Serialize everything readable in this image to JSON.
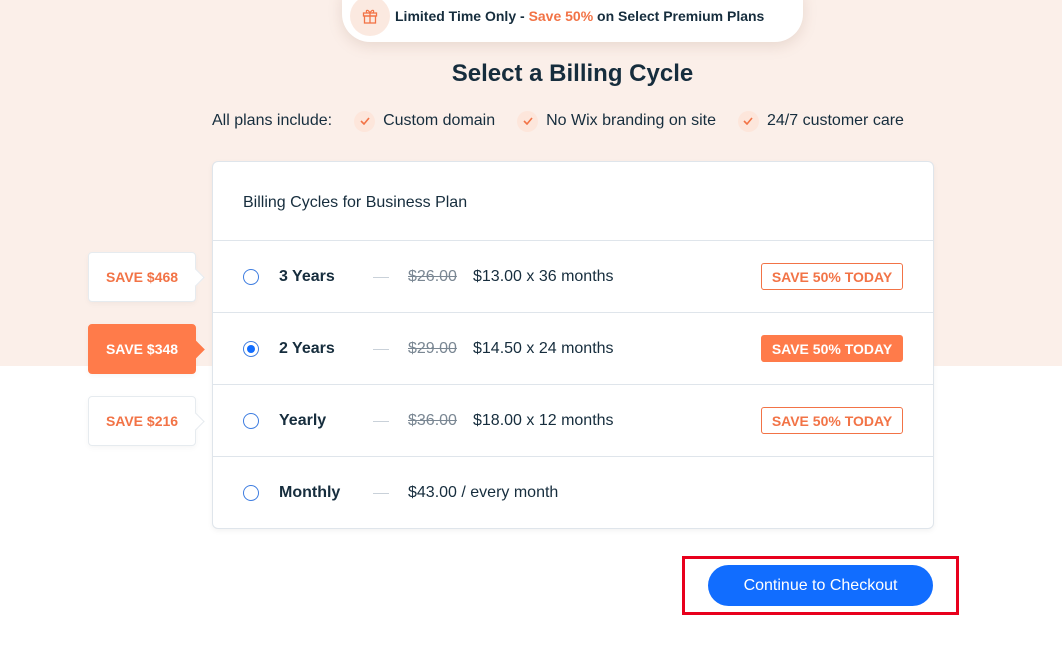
{
  "promo": {
    "icon": "gift-icon",
    "text_lead": "Limited Time Only",
    "separator": " - ",
    "text_accent": "Save 50%",
    "text_tail": " on Select Premium Plans"
  },
  "heading": "Select a Billing Cycle",
  "features": {
    "lead": "All plans include:",
    "items": [
      "Custom domain",
      "No Wix branding on site",
      "24/7 customer care"
    ]
  },
  "billing": {
    "title": "Billing Cycles for Business Plan",
    "selected_index": 1,
    "options": [
      {
        "label": "3 Years",
        "old_price": "$26.00",
        "price": "$13.00 x 36 months",
        "tag": "SAVE 50% TODAY",
        "side_badge": "SAVE $468"
      },
      {
        "label": "2 Years",
        "old_price": "$29.00",
        "price": "$14.50 x 24 months",
        "tag": "SAVE 50% TODAY",
        "side_badge": "SAVE $348"
      },
      {
        "label": "Yearly",
        "old_price": "$36.00",
        "price": "$18.00 x 12 months",
        "tag": "SAVE 50% TODAY",
        "side_badge": "SAVE $216"
      },
      {
        "label": "Monthly",
        "old_price": "",
        "price": "$43.00 / every month",
        "tag": "",
        "side_badge": ""
      }
    ]
  },
  "checkout": {
    "label": "Continue to Checkout"
  },
  "colors": {
    "accent": "#f27346",
    "accent_fill": "#ff7b4a",
    "primary": "#116dff",
    "band": "#fbefe9",
    "highlight": "#e8001c"
  }
}
